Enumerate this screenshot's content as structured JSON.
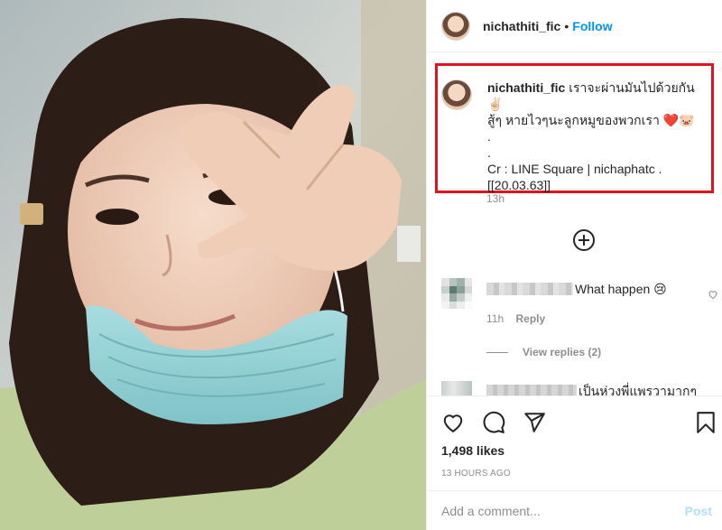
{
  "header": {
    "username": "nichathiti_fic",
    "separator": "•",
    "follow_label": "Follow"
  },
  "caption": {
    "username": "nichathiti_fic",
    "line1": "เราจะผ่านมันไปด้วยกัน ✌🏻",
    "line2": "สู้ๆ หายไวๆนะลูกหมูของพวกเรา ❤️🐷",
    "line3": ".",
    "line4": ".",
    "line5": "Cr : LINE Square | nichaphatc .",
    "line6": "[[20.03.63]]",
    "time": "13h"
  },
  "comments": [
    {
      "text": "What happen 😢",
      "time": "11h",
      "reply_label": "Reply",
      "view_replies": "View replies (2)"
    },
    {
      "text": "เป็นห่วงพี่แพรวามากๆ"
    }
  ],
  "actions": {
    "like_icon": "heart-icon",
    "comment_icon": "comment-icon",
    "share_icon": "share-icon",
    "save_icon": "bookmark-icon"
  },
  "likes": "1,498 likes",
  "post_time": "13 HOURS AGO",
  "add_comment": {
    "placeholder": "Add a comment...",
    "post_label": "Post"
  },
  "colors": {
    "follow": "#0095f6",
    "highlight_box": "#e0141e",
    "post_disabled": "#b2dffc"
  }
}
